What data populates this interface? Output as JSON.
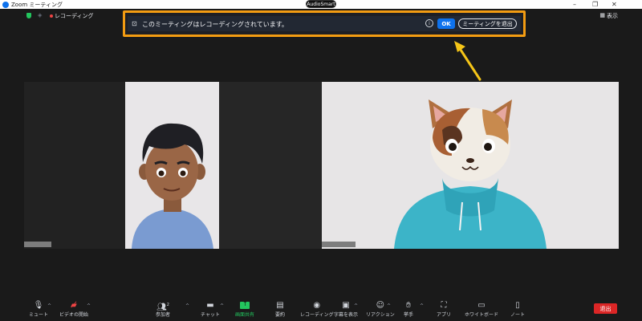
{
  "window": {
    "title": "Zoom ミーティング",
    "minimize": "–",
    "maximize": "❐",
    "close": "✕"
  },
  "topbar": {
    "recording_label": "レコーディング",
    "view_label": "表示",
    "view_icon": "▦"
  },
  "audiosmart": "AudioSmart",
  "banner": {
    "message": "このミーティングはレコーディングされています。",
    "ok_label": "OK",
    "leave_label": "ミーティングを退出",
    "info_glyph": "i",
    "rec_glyph": "⊡"
  },
  "toolbar": {
    "mute": "ミュート",
    "video": "ビデオの開始",
    "participants": "参加者",
    "participants_count": "2",
    "chat": "チャット",
    "share": "画面共有",
    "summary": "要約",
    "record": "レコーディング",
    "captions": "字幕を表示",
    "reactions": "リアクション",
    "raise_hand": "挙手",
    "apps": "アプリ",
    "whiteboard": "ホワイトボード",
    "notes": "ノート",
    "end": "退出"
  },
  "colors": {
    "accent": "#0e72ed",
    "highlight": "#f39c12",
    "share_green": "#23c55e",
    "end_red": "#dc2626"
  }
}
